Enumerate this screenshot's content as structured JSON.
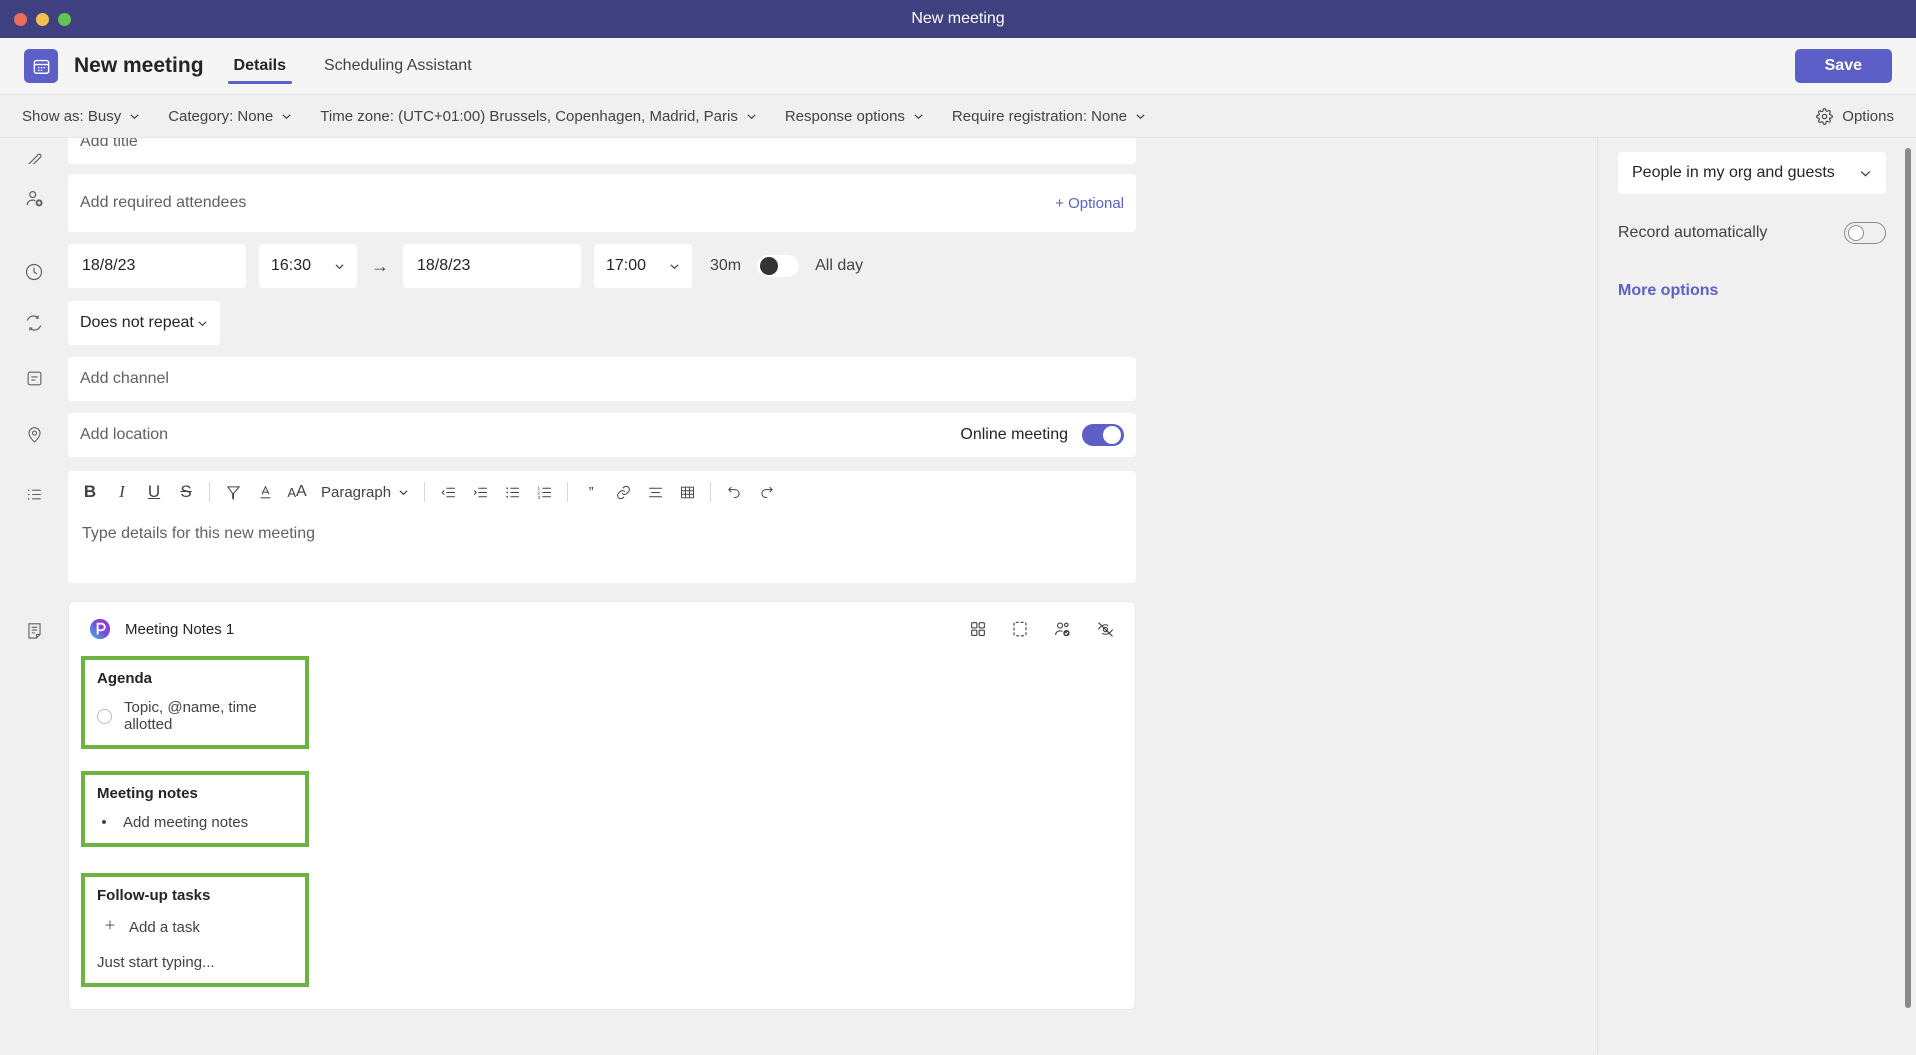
{
  "window": {
    "title": "New meeting"
  },
  "header": {
    "app_title": "New meeting",
    "app_icon": "calendar-icon",
    "tabs": [
      {
        "label": "Details",
        "active": true
      },
      {
        "label": "Scheduling Assistant",
        "active": false
      }
    ],
    "save_label": "Save"
  },
  "options_bar": {
    "items": [
      {
        "label": "Show as: Busy"
      },
      {
        "label": "Category: None"
      },
      {
        "label": "Time zone: (UTC+01:00) Brussels, Copenhagen, Madrid, Paris"
      },
      {
        "label": "Response options"
      },
      {
        "label": "Require registration: None"
      }
    ],
    "options_label": "Options",
    "options_icon": "gear-icon"
  },
  "form": {
    "title_placeholder": "Add title",
    "attendees_placeholder": "Add required attendees",
    "optional_label": "+ Optional",
    "start_date": "18/8/23",
    "start_time": "16:30",
    "end_date": "18/8/23",
    "end_time": "17:00",
    "duration": "30m",
    "all_day_label": "All day",
    "all_day_on": false,
    "repeat_value": "Does not repeat",
    "channel_placeholder": "Add channel",
    "location_placeholder": "Add location",
    "online_meeting_label": "Online meeting",
    "online_meeting_on": true
  },
  "editor": {
    "paragraph_label": "Paragraph",
    "body_placeholder": "Type details for this new meeting",
    "tools": [
      "bold-icon",
      "italic-icon",
      "underline-icon",
      "strikethrough-icon",
      "highlight-icon",
      "font-color-icon",
      "font-size-icon",
      "decrease-indent-icon",
      "increase-indent-icon",
      "bulleted-list-icon",
      "numbered-list-icon",
      "quote-icon",
      "link-icon",
      "align-icon",
      "table-icon",
      "undo-icon",
      "redo-icon"
    ]
  },
  "notes": {
    "title": "Meeting Notes 1",
    "logo_icon": "loop-icon",
    "actions": [
      "apps-grid-icon",
      "expand-frame-icon",
      "people-permissions-icon",
      "hide-eye-icon"
    ],
    "sections": [
      {
        "heading": "Agenda",
        "item_marker": "radio",
        "item_text": "Topic, @name, time allotted",
        "highlighted": true
      },
      {
        "heading": "Meeting notes",
        "item_marker": "bullet",
        "item_text": "Add meeting notes",
        "highlighted": true
      },
      {
        "heading": "Follow-up tasks",
        "item_marker": "plus",
        "item_text": "Add a task",
        "extra_text": "Just start typing...",
        "highlighted": true
      }
    ],
    "highlight_color": "#6cb33f"
  },
  "right_panel": {
    "audience_value": "People in my org and guests",
    "record_label": "Record automatically",
    "record_on": false,
    "more_options_label": "More options"
  },
  "colors": {
    "titlebar": "#3f4080",
    "accent": "#5b5fc7",
    "highlight_green": "#6cb33f",
    "page_bg": "#f0f0f0"
  }
}
